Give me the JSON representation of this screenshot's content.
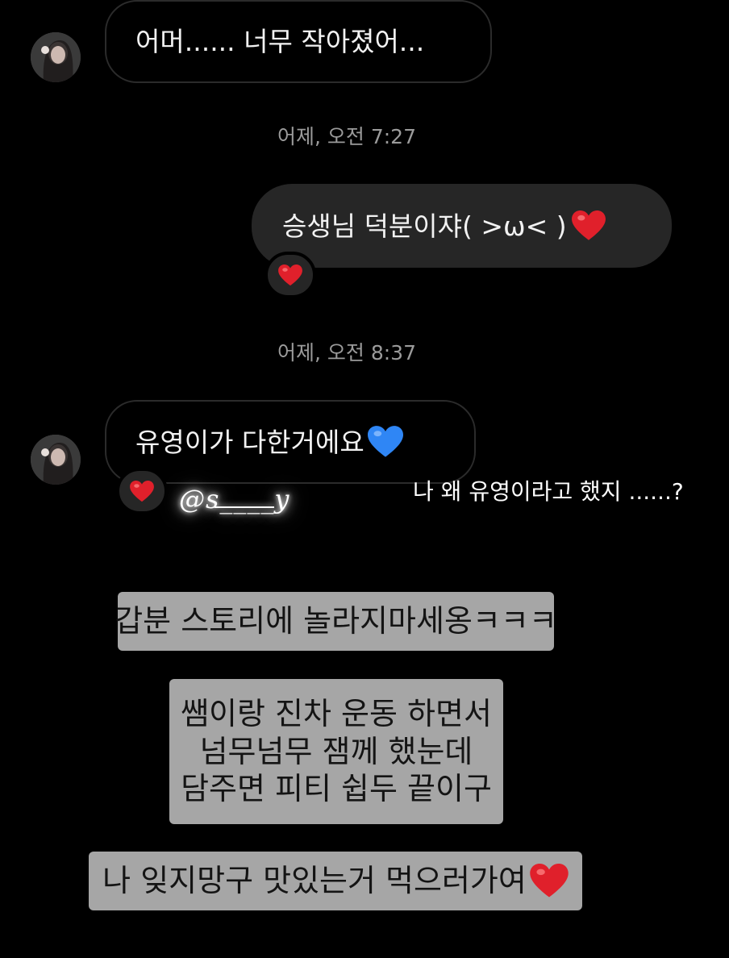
{
  "messages": {
    "msg1": {
      "text": "어머...... 너무 작아졌어..."
    },
    "timestamp1": "어제, 오전 7:27",
    "msg2": {
      "text": "승생님 덕분이쟈( >ω< )",
      "emoji": "red-heart"
    },
    "msg2_reaction": "red-heart",
    "timestamp2": "어제, 오전 8:37",
    "msg3": {
      "text": "유영이가 다한거에요",
      "emoji": "blue-heart"
    },
    "msg3_reaction": "red-heart"
  },
  "story_overlay": {
    "mention": "@s____y",
    "caption": "나 왜 유영이라고 했지 ......?",
    "text_blocks": [
      {
        "lines": [
          "갑분 스토리에 놀라지마세옹ㅋㅋㅋ"
        ]
      },
      {
        "lines": [
          "쌤이랑 진차 운동 하면서",
          "넘무넘무 잼께 했눈데",
          "담주면 피티 쉽두 끝이구"
        ]
      },
      {
        "lines": [
          "나 잊지망구 맛있는거 먹으러가여"
        ],
        "emoji": "red-heart"
      }
    ]
  },
  "colors": {
    "background": "#000000",
    "outgoing_bubble": "#262626",
    "incoming_border": "#2b2b2b",
    "timestamp": "#9b9b9b",
    "story_text_bg": "#a6a6a6",
    "red_heart": "#e0202b",
    "blue_heart": "#2f86f5"
  }
}
